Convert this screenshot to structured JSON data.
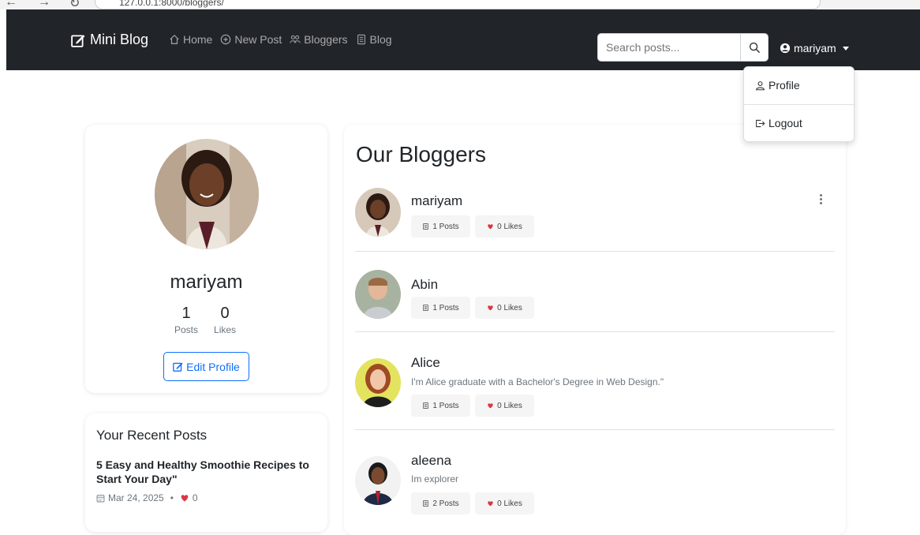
{
  "browser": {
    "url": "127.0.0.1:8000/bloggers/"
  },
  "navbar": {
    "brand": "Mini Blog",
    "links": [
      {
        "label": "Home",
        "icon": "house-icon"
      },
      {
        "label": "New Post",
        "icon": "plus-circle-icon"
      },
      {
        "label": "Bloggers",
        "icon": "people-icon"
      },
      {
        "label": "Blog",
        "icon": "journal-icon"
      }
    ],
    "search_placeholder": "Search posts...",
    "user": "mariyam"
  },
  "dropdown": {
    "items": [
      {
        "label": "Profile",
        "icon": "person-icon"
      },
      {
        "label": "Logout",
        "icon": "box-arrow-right-icon"
      }
    ]
  },
  "profile": {
    "name": "mariyam",
    "posts": "1",
    "posts_label": "Posts",
    "likes": "0",
    "likes_label": "Likes",
    "edit_label": "Edit Profile"
  },
  "recent": {
    "title": "Your Recent Posts",
    "post_title": "5 Easy and Healthy Smoothie Recipes to Start Your Day\"",
    "date": "Mar 24, 2025",
    "separator": "•",
    "likes": "0"
  },
  "bloggers": {
    "title": "Our Bloggers",
    "list": [
      {
        "name": "mariyam",
        "bio": "",
        "posts": "1 Posts",
        "likes": "0 Likes"
      },
      {
        "name": "Abin",
        "bio": "",
        "posts": "1 Posts",
        "likes": "0 Likes"
      },
      {
        "name": "Alice",
        "bio": "I'm Alice graduate with a Bachelor's Degree in Web Design.\"",
        "posts": "1 Posts",
        "likes": "0 Likes"
      },
      {
        "name": "aleena",
        "bio": "Im explorer",
        "posts": "2 Posts",
        "likes": "0 Likes"
      }
    ]
  },
  "colors": {
    "navbar": "#212529",
    "primary": "#0d6efd",
    "heart": "#dc3545"
  }
}
